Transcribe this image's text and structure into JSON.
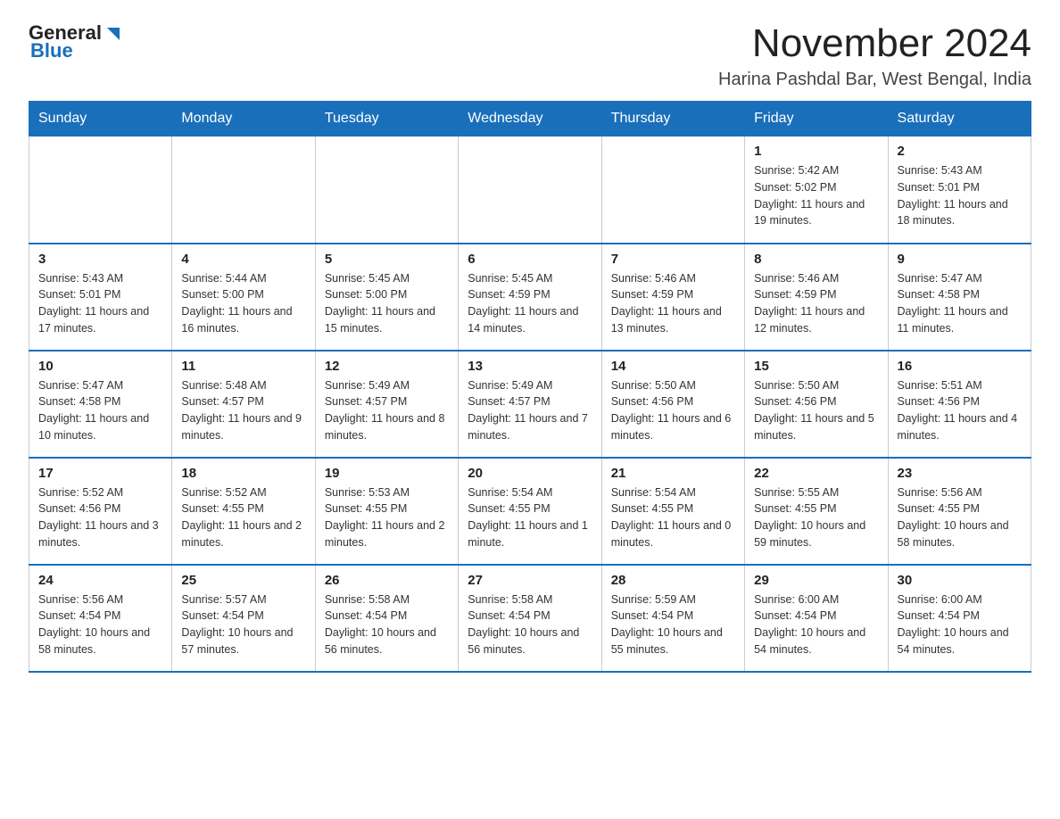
{
  "logo": {
    "text_general": "General",
    "text_blue": "Blue"
  },
  "title": "November 2024",
  "subtitle": "Harina Pashdal Bar, West Bengal, India",
  "days_of_week": [
    "Sunday",
    "Monday",
    "Tuesday",
    "Wednesday",
    "Thursday",
    "Friday",
    "Saturday"
  ],
  "weeks": [
    [
      {
        "day": "",
        "info": ""
      },
      {
        "day": "",
        "info": ""
      },
      {
        "day": "",
        "info": ""
      },
      {
        "day": "",
        "info": ""
      },
      {
        "day": "",
        "info": ""
      },
      {
        "day": "1",
        "info": "Sunrise: 5:42 AM\nSunset: 5:02 PM\nDaylight: 11 hours and 19 minutes."
      },
      {
        "day": "2",
        "info": "Sunrise: 5:43 AM\nSunset: 5:01 PM\nDaylight: 11 hours and 18 minutes."
      }
    ],
    [
      {
        "day": "3",
        "info": "Sunrise: 5:43 AM\nSunset: 5:01 PM\nDaylight: 11 hours and 17 minutes."
      },
      {
        "day": "4",
        "info": "Sunrise: 5:44 AM\nSunset: 5:00 PM\nDaylight: 11 hours and 16 minutes."
      },
      {
        "day": "5",
        "info": "Sunrise: 5:45 AM\nSunset: 5:00 PM\nDaylight: 11 hours and 15 minutes."
      },
      {
        "day": "6",
        "info": "Sunrise: 5:45 AM\nSunset: 4:59 PM\nDaylight: 11 hours and 14 minutes."
      },
      {
        "day": "7",
        "info": "Sunrise: 5:46 AM\nSunset: 4:59 PM\nDaylight: 11 hours and 13 minutes."
      },
      {
        "day": "8",
        "info": "Sunrise: 5:46 AM\nSunset: 4:59 PM\nDaylight: 11 hours and 12 minutes."
      },
      {
        "day": "9",
        "info": "Sunrise: 5:47 AM\nSunset: 4:58 PM\nDaylight: 11 hours and 11 minutes."
      }
    ],
    [
      {
        "day": "10",
        "info": "Sunrise: 5:47 AM\nSunset: 4:58 PM\nDaylight: 11 hours and 10 minutes."
      },
      {
        "day": "11",
        "info": "Sunrise: 5:48 AM\nSunset: 4:57 PM\nDaylight: 11 hours and 9 minutes."
      },
      {
        "day": "12",
        "info": "Sunrise: 5:49 AM\nSunset: 4:57 PM\nDaylight: 11 hours and 8 minutes."
      },
      {
        "day": "13",
        "info": "Sunrise: 5:49 AM\nSunset: 4:57 PM\nDaylight: 11 hours and 7 minutes."
      },
      {
        "day": "14",
        "info": "Sunrise: 5:50 AM\nSunset: 4:56 PM\nDaylight: 11 hours and 6 minutes."
      },
      {
        "day": "15",
        "info": "Sunrise: 5:50 AM\nSunset: 4:56 PM\nDaylight: 11 hours and 5 minutes."
      },
      {
        "day": "16",
        "info": "Sunrise: 5:51 AM\nSunset: 4:56 PM\nDaylight: 11 hours and 4 minutes."
      }
    ],
    [
      {
        "day": "17",
        "info": "Sunrise: 5:52 AM\nSunset: 4:56 PM\nDaylight: 11 hours and 3 minutes."
      },
      {
        "day": "18",
        "info": "Sunrise: 5:52 AM\nSunset: 4:55 PM\nDaylight: 11 hours and 2 minutes."
      },
      {
        "day": "19",
        "info": "Sunrise: 5:53 AM\nSunset: 4:55 PM\nDaylight: 11 hours and 2 minutes."
      },
      {
        "day": "20",
        "info": "Sunrise: 5:54 AM\nSunset: 4:55 PM\nDaylight: 11 hours and 1 minute."
      },
      {
        "day": "21",
        "info": "Sunrise: 5:54 AM\nSunset: 4:55 PM\nDaylight: 11 hours and 0 minutes."
      },
      {
        "day": "22",
        "info": "Sunrise: 5:55 AM\nSunset: 4:55 PM\nDaylight: 10 hours and 59 minutes."
      },
      {
        "day": "23",
        "info": "Sunrise: 5:56 AM\nSunset: 4:55 PM\nDaylight: 10 hours and 58 minutes."
      }
    ],
    [
      {
        "day": "24",
        "info": "Sunrise: 5:56 AM\nSunset: 4:54 PM\nDaylight: 10 hours and 58 minutes."
      },
      {
        "day": "25",
        "info": "Sunrise: 5:57 AM\nSunset: 4:54 PM\nDaylight: 10 hours and 57 minutes."
      },
      {
        "day": "26",
        "info": "Sunrise: 5:58 AM\nSunset: 4:54 PM\nDaylight: 10 hours and 56 minutes."
      },
      {
        "day": "27",
        "info": "Sunrise: 5:58 AM\nSunset: 4:54 PM\nDaylight: 10 hours and 56 minutes."
      },
      {
        "day": "28",
        "info": "Sunrise: 5:59 AM\nSunset: 4:54 PM\nDaylight: 10 hours and 55 minutes."
      },
      {
        "day": "29",
        "info": "Sunrise: 6:00 AM\nSunset: 4:54 PM\nDaylight: 10 hours and 54 minutes."
      },
      {
        "day": "30",
        "info": "Sunrise: 6:00 AM\nSunset: 4:54 PM\nDaylight: 10 hours and 54 minutes."
      }
    ]
  ]
}
